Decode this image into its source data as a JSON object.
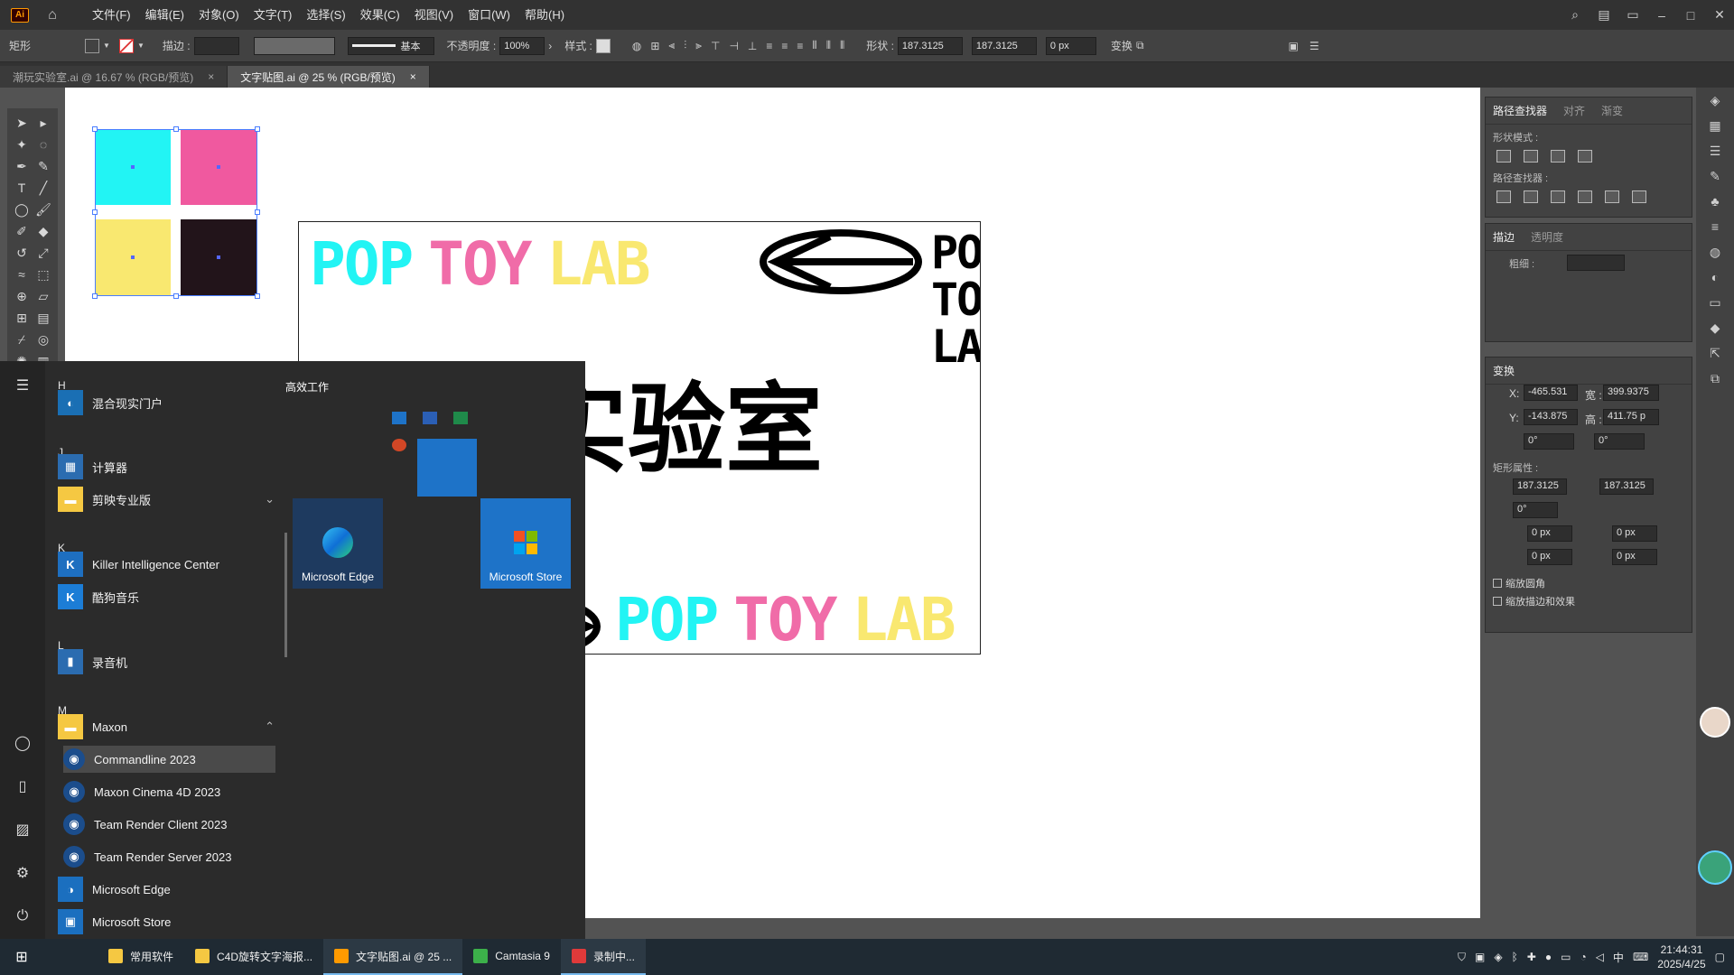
{
  "titlebar": {
    "logo": "Ai",
    "menus": [
      "文件(F)",
      "编辑(E)",
      "对象(O)",
      "文字(T)",
      "选择(S)",
      "效果(C)",
      "视图(V)",
      "窗口(W)",
      "帮助(H)"
    ]
  },
  "controlbar": {
    "object_type": "矩形",
    "stroke_label": "描边 :",
    "stroke_style": "基本",
    "opacity_label": "不透明度 :",
    "opacity_value": "100%",
    "style_label": "样式 :",
    "shape_label": "形状 :",
    "width": "187.3125",
    "height": "187.3125",
    "corner": "0 px",
    "transform_label": "变换"
  },
  "tabs": [
    {
      "label": "潮玩实验室.ai @ 16.67 % (RGB/预览)",
      "close": "×"
    },
    {
      "label": "文字贴图.ai @ 25 % (RGB/预览)",
      "close": "×"
    }
  ],
  "artboard": {
    "swatch_colors": [
      "#22f4f4",
      "#f0599f",
      "#f9e870",
      "#22141a"
    ],
    "poster": {
      "title_words": [
        "POP",
        "TOY",
        "LAB"
      ],
      "word_colors": [
        "#22f4f4",
        "#f06ca8",
        "#f9e870"
      ],
      "stack_words": [
        "POP",
        "TOY",
        "LAB"
      ],
      "chinese_title": "潮玩实验室",
      "bottom_words": [
        "POP",
        "TOY",
        "LAB"
      ]
    }
  },
  "panels": {
    "pathfinder": {
      "tabs": [
        "路径查找器",
        "对齐",
        "渐变"
      ],
      "shape_mode_label": "形状模式 :",
      "pathfinder_label": "路径查找器 :"
    },
    "stroke": {
      "tabs": [
        "描边",
        "透明度"
      ],
      "weight_label": "粗细 :"
    },
    "transform": {
      "title": "变换",
      "x_label": "X:",
      "x_value": "-465.531",
      "w_label": "宽 :",
      "w_value": "399.9375",
      "y_label": "Y:",
      "y_value": "-143.875",
      "h_label": "高 :",
      "h_value": "411.75 p",
      "angle_value": "0°",
      "shear_value": "0°",
      "rect_props_label": "矩形属性 :",
      "rect_w": "187.3125",
      "rect_h": "187.3125",
      "rect_angle": "0°",
      "corner1": "0 px",
      "corner2": "0 px",
      "corner3": "0 px",
      "corner4": "0 px",
      "scale_corners": "缩放圆角",
      "scale_strokes": "缩放描边和效果"
    }
  },
  "startmenu": {
    "letters": [
      "H",
      "J",
      "K",
      "L",
      "M"
    ],
    "apps": [
      {
        "name": "混合现实门户",
        "icon": "◐",
        "color": "#1a6fb4"
      },
      {
        "name": "计算器",
        "icon": "▦",
        "color": "#2b6cb0"
      },
      {
        "name": "剪映专业版",
        "icon": "▬",
        "color": "#f5c842"
      },
      {
        "name": "Killer Intelligence Center",
        "icon": "K",
        "color": "#1e6fc0"
      },
      {
        "name": "酷狗音乐",
        "icon": "K",
        "color": "#1c7dd6"
      },
      {
        "name": "录音机",
        "icon": "▮",
        "color": "#2b6cb0"
      },
      {
        "name": "Maxon",
        "icon": "▬",
        "color": "#f5c842"
      },
      {
        "name": "Commandline 2023",
        "icon": "◉",
        "color": "#1b4d8c"
      },
      {
        "name": "Maxon Cinema 4D 2023",
        "icon": "◉",
        "color": "#1b4d8c"
      },
      {
        "name": "Team Render Client 2023",
        "icon": "◉",
        "color": "#1b4d8c"
      },
      {
        "name": "Team Render Server 2023",
        "icon": "◉",
        "color": "#1b4d8c"
      },
      {
        "name": "Microsoft Edge",
        "icon": "◑",
        "color": "#1b6fbf"
      },
      {
        "name": "Microsoft Store",
        "icon": "▣",
        "color": "#1b6fbf"
      }
    ],
    "tiles_header": "高效工作",
    "tile_edge": "Microsoft Edge",
    "tile_store": "Microsoft Store"
  },
  "taskbar": {
    "apps": [
      {
        "label": "常用软件",
        "color": "#f5c842"
      },
      {
        "label": "C4D旋转文字海报...",
        "color": "#f5c842"
      },
      {
        "label": "文字贴图.ai @ 25 ...",
        "color": "#ff9a00"
      },
      {
        "label": "Camtasia 9",
        "color": "#3cb04a"
      },
      {
        "label": "录制中...",
        "color": "#e03a3a"
      }
    ],
    "ime": "中",
    "time": "21:44:31",
    "date": "2025/4/25"
  }
}
